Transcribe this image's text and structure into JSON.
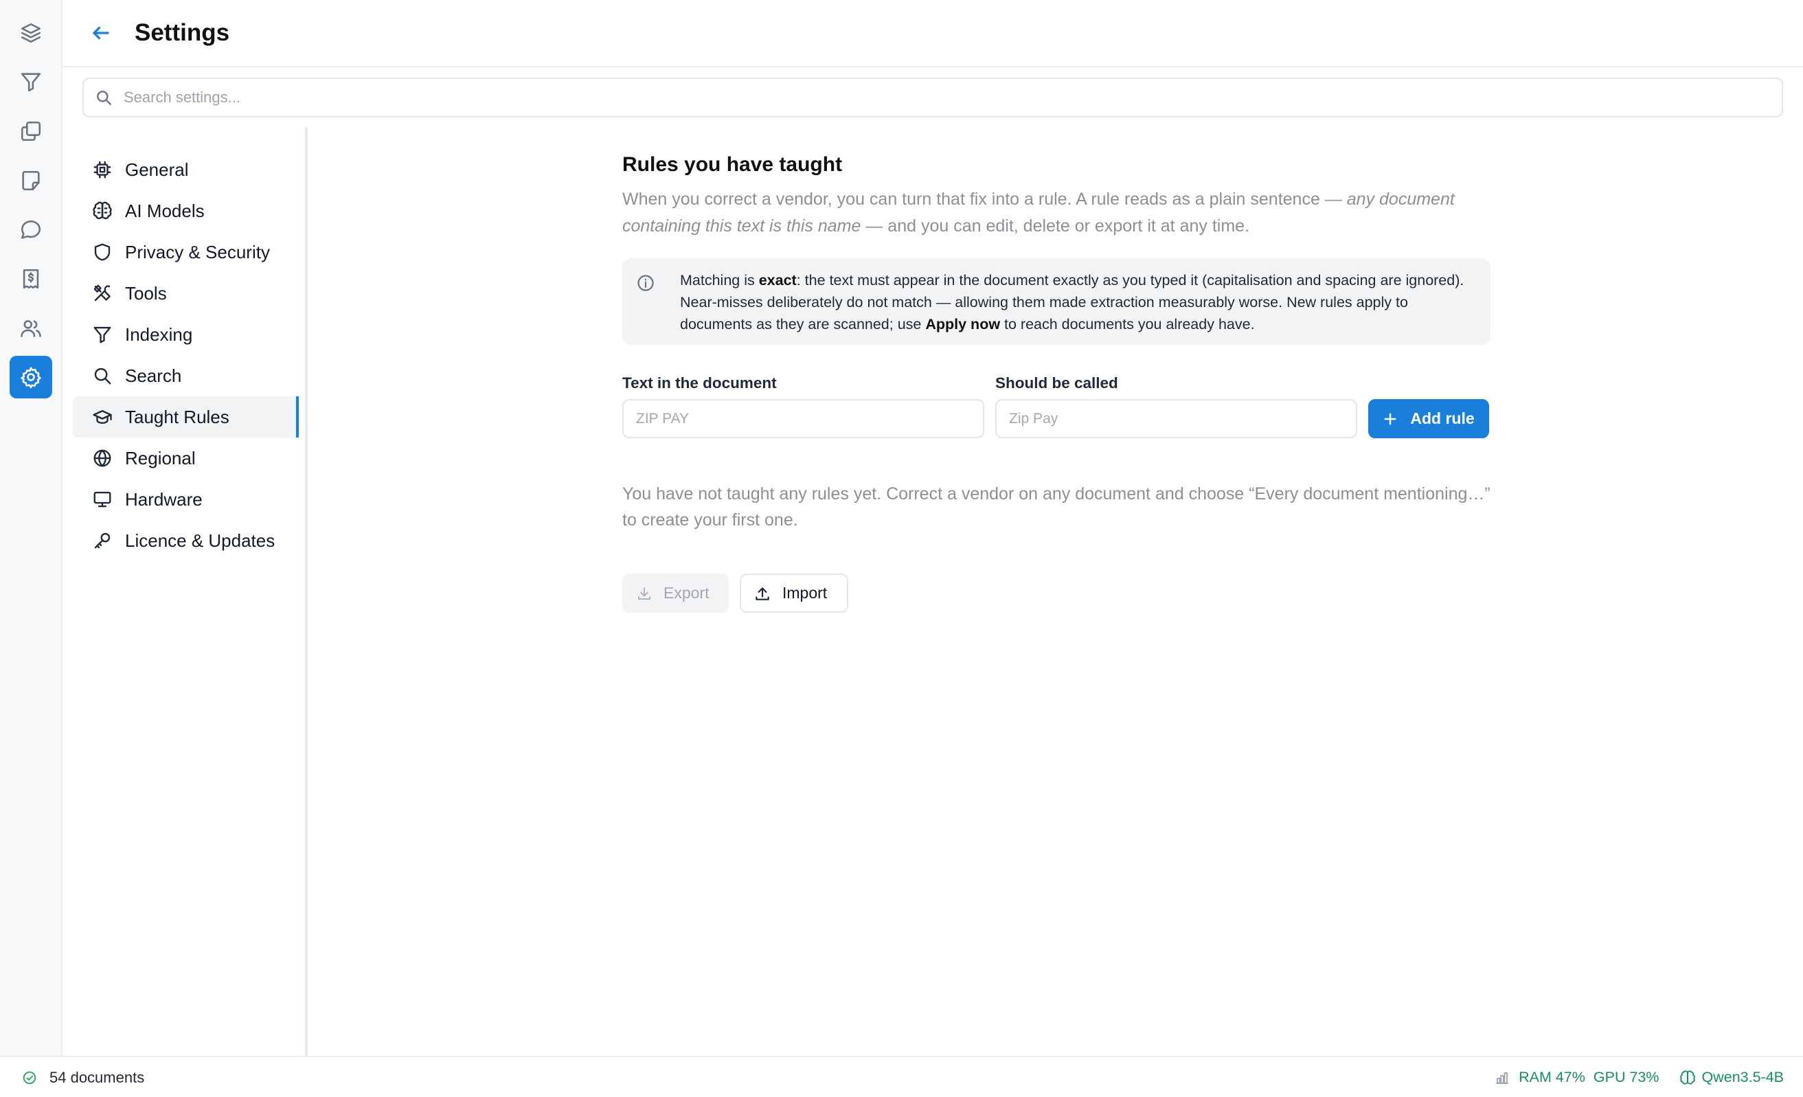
{
  "rail": {
    "items": [
      {
        "name": "layers-icon",
        "active": false
      },
      {
        "name": "filter-icon",
        "active": false
      },
      {
        "name": "documents-icon",
        "active": false
      },
      {
        "name": "note-icon",
        "active": false
      },
      {
        "name": "chat-icon",
        "active": false
      },
      {
        "name": "receipt-icon",
        "active": false
      },
      {
        "name": "users-icon",
        "active": false
      },
      {
        "name": "settings-icon",
        "active": true
      }
    ]
  },
  "header": {
    "title": "Settings"
  },
  "search": {
    "placeholder": "Search settings..."
  },
  "nav": {
    "active": "Taught Rules",
    "items": [
      {
        "label": "General",
        "icon": "chip-icon"
      },
      {
        "label": "AI Models",
        "icon": "brain-icon"
      },
      {
        "label": "Privacy & Security",
        "icon": "shield-icon"
      },
      {
        "label": "Tools",
        "icon": "tools-icon"
      },
      {
        "label": "Indexing",
        "icon": "filter-icon"
      },
      {
        "label": "Search",
        "icon": "search-icon"
      },
      {
        "label": "Taught Rules",
        "icon": "graduation-cap-icon"
      },
      {
        "label": "Regional",
        "icon": "globe-icon"
      },
      {
        "label": "Hardware",
        "icon": "monitor-icon"
      },
      {
        "label": "Licence & Updates",
        "icon": "key-icon"
      }
    ]
  },
  "main": {
    "title": "Rules you have taught",
    "desc_1": "When you correct a vendor, you can turn that fix into a rule. A rule reads as a plain sentence — ",
    "desc_em": "any document containing this text is this name",
    "desc_2": " — and you can edit, delete or export it at any time.",
    "info": {
      "t1": "Matching is ",
      "b1": "exact",
      "t2": ": the text must appear in the document exactly as you typed it (capitalisation and spacing are ignored). Near-misses deliberately do not match — allowing them made extraction measurably worse. New rules apply to documents as they are scanned; use ",
      "b2": "Apply now",
      "t3": " to reach documents you already have."
    },
    "form": {
      "text_label": "Text in the document",
      "text_placeholder": "ZIP PAY",
      "name_label": "Should be called",
      "name_placeholder": "Zip Pay",
      "add_label": "Add rule"
    },
    "empty_text": "You have not taught any rules yet. Correct a vendor on any document and choose “Every document mentioning…” to create your first one.",
    "export_label": "Export",
    "import_label": "Import"
  },
  "status": {
    "documents": "54 documents",
    "ram": "RAM 47%",
    "gpu": "GPU 73%",
    "model": "Qwen3.5-4B"
  },
  "colors": {
    "accent": "#1a7fdb",
    "ok": "#22a55b",
    "status_text": "#16915a"
  }
}
